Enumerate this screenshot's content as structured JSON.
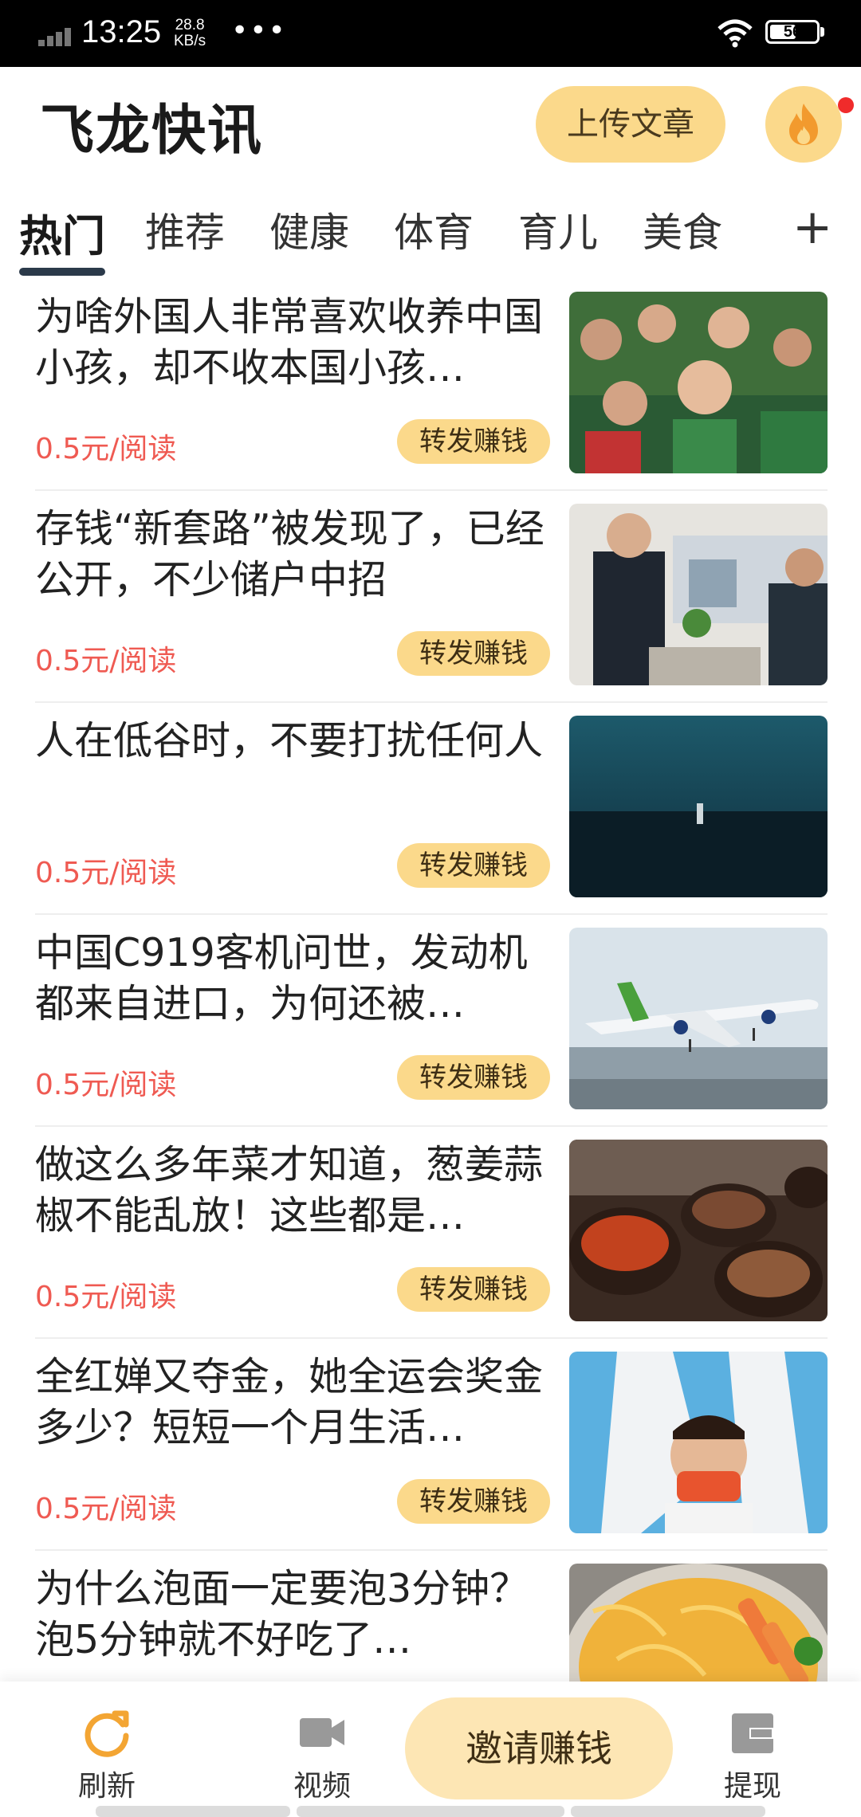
{
  "status_bar": {
    "time": "13:25",
    "speed_value": "28.8",
    "speed_unit": "KB/s",
    "dots": "•••",
    "battery": "56"
  },
  "header": {
    "title": "飞龙快讯",
    "upload_label": "上传文章",
    "fire_icon": "fire-icon"
  },
  "tabs": {
    "items": [
      "热门",
      "推荐",
      "健康",
      "体育",
      "育儿",
      "美食"
    ],
    "active": "热门",
    "add_label": "+"
  },
  "articles": [
    {
      "title": "为啥外国人非常喜欢收养中国小孩，却不收本国小孩…",
      "price": "0.5元/阅读",
      "share": "转发赚钱"
    },
    {
      "title": "存钱“新套路”被发现了，已经公开，不少储户中招",
      "price": "0.5元/阅读",
      "share": "转发赚钱"
    },
    {
      "title": "人在低谷时，不要打扰任何人",
      "price": "0.5元/阅读",
      "share": "转发赚钱"
    },
    {
      "title": "中国C919客机问世，发动机都来自进口，为何还被…",
      "price": "0.5元/阅读",
      "share": "转发赚钱"
    },
    {
      "title": "做这么多年菜才知道，葱姜蒜椒不能乱放！这些都是…",
      "price": "0.5元/阅读",
      "share": "转发赚钱"
    },
    {
      "title": "全红婵又夺金，她全运会奖金多少？短短一个月生活…",
      "price": "0.5元/阅读",
      "share": "转发赚钱"
    },
    {
      "title": "为什么泡面一定要泡3分钟？泡5分钟就不好吃了…",
      "price": "",
      "share": ""
    }
  ],
  "bottom_nav": {
    "refresh_label": "刷新",
    "video_label": "视频",
    "invite_label": "邀请赚钱",
    "withdraw_label": "提现"
  },
  "colors": {
    "accent": "#fbd98b",
    "price": "#ef5a52",
    "refresh_icon": "#f3a533",
    "nav_icon": "#999999"
  }
}
